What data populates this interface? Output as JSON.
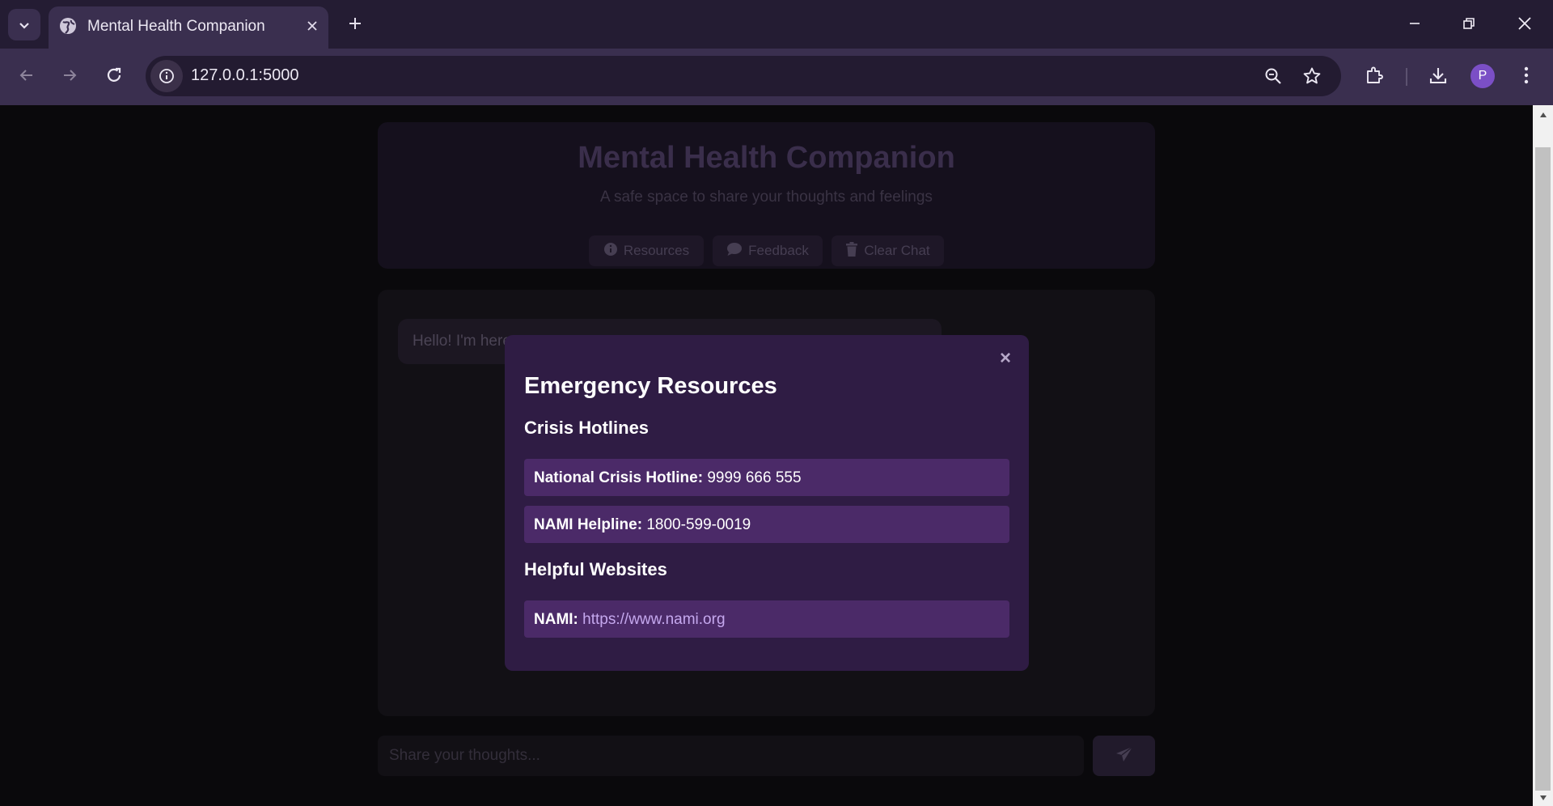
{
  "browser": {
    "tab_title": "Mental Health Companion",
    "url": "127.0.0.1:5000",
    "profile_initial": "P"
  },
  "header": {
    "title": "Mental Health Companion",
    "subtitle": "A safe space to share your thoughts and feelings",
    "buttons": {
      "resources": "Resources",
      "feedback": "Feedback",
      "clear": "Clear Chat"
    }
  },
  "chat": {
    "bot_message": "Hello! I'm here",
    "input_placeholder": "Share your thoughts..."
  },
  "modal": {
    "title": "Emergency Resources",
    "close_symbol": "×",
    "hotlines_heading": "Crisis Hotlines",
    "hotlines": [
      {
        "label": "National Crisis Hotline:",
        "value": "9999 666 555"
      },
      {
        "label": "NAMI Helpline:",
        "value": "1800-599-0019"
      }
    ],
    "websites_heading": "Helpful Websites",
    "websites": [
      {
        "label": "NAMI:",
        "value": "https://www.nami.org"
      }
    ]
  },
  "colors": {
    "modal_bg": "#2f1c44",
    "resource_item_bg": "#4b2a68",
    "link": "#c5a8ee",
    "avatar": "#7b4fc6"
  },
  "icons": [
    "tab-search-icon",
    "globe-icon",
    "close-icon",
    "plus-icon",
    "minimize-icon",
    "restore-icon",
    "back-icon",
    "forward-icon",
    "reload-icon",
    "info-icon",
    "zoom-icon",
    "star-icon",
    "extensions-icon",
    "download-icon",
    "menu-icon",
    "trash-icon",
    "comment-icon",
    "send-icon"
  ]
}
